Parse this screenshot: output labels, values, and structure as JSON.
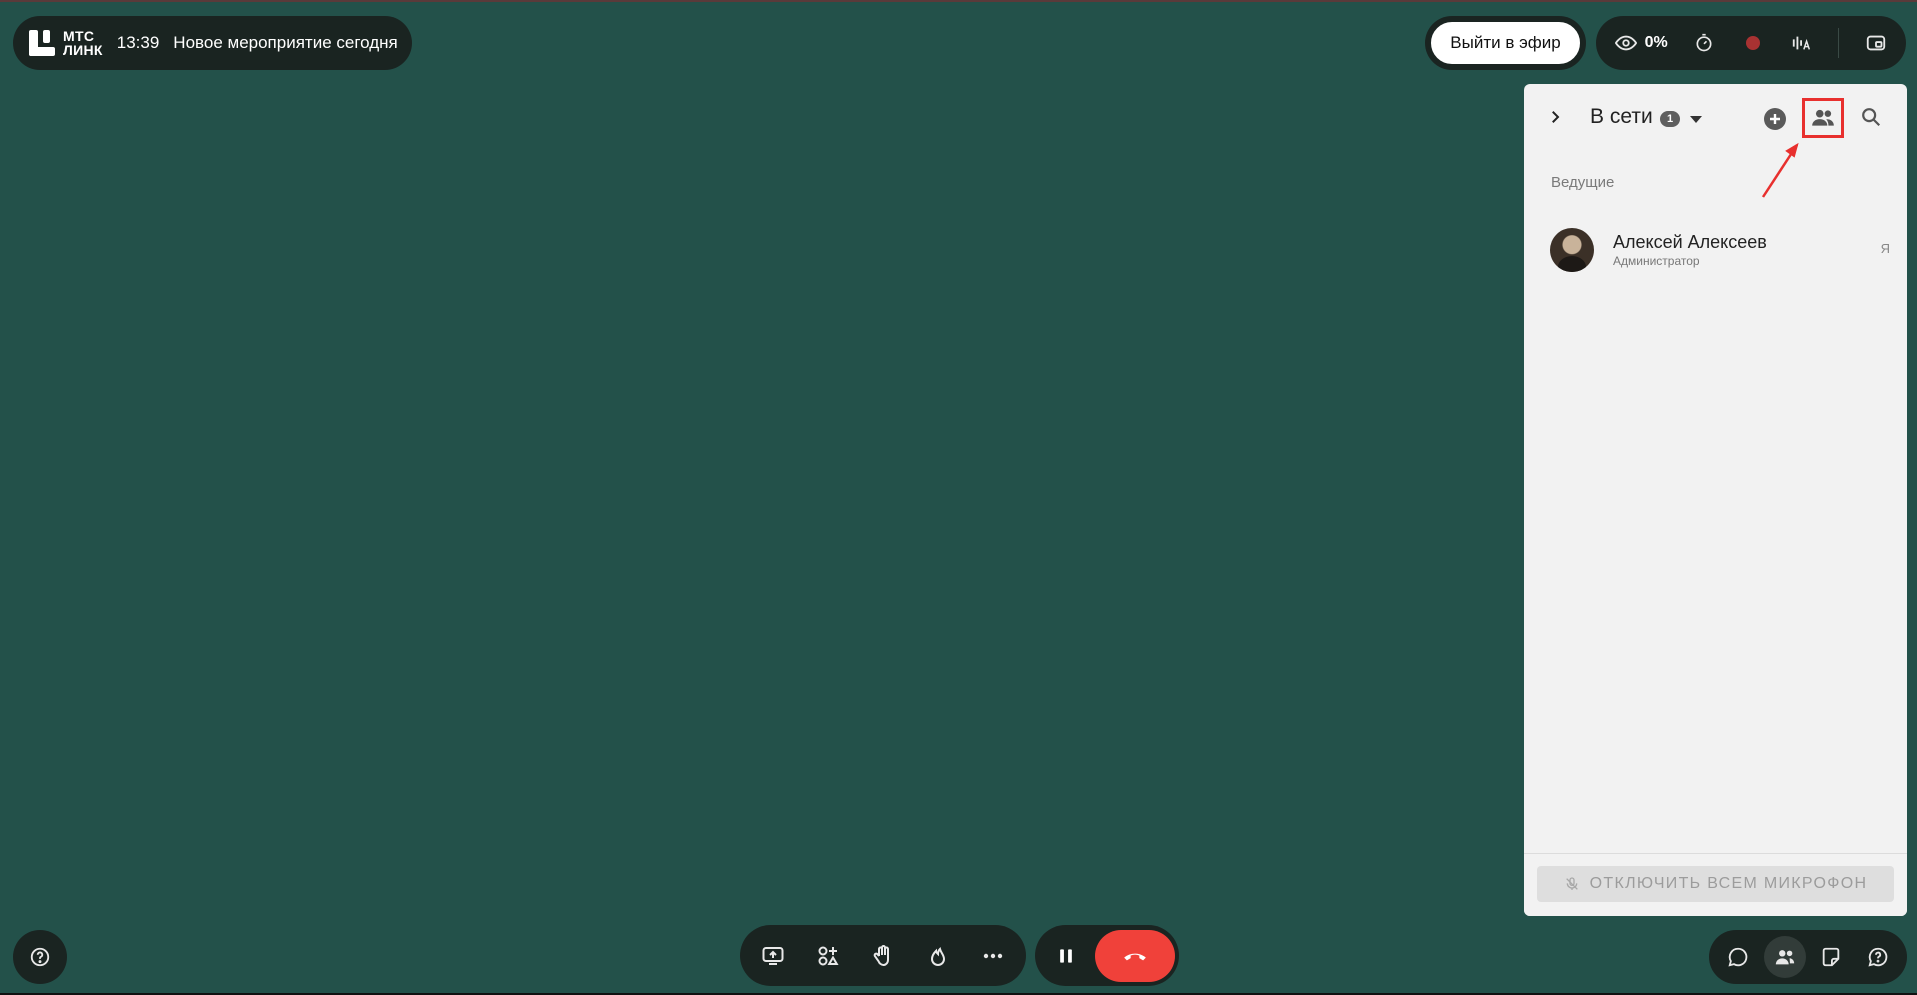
{
  "header": {
    "logo_line1": "МТС",
    "logo_line2": "ЛИНК",
    "time": "13:39",
    "event_title": "Новое мероприятие сегодня"
  },
  "top_right": {
    "go_live_label": "Выйти в эфир",
    "viewers_percent": "0%",
    "icons": [
      "eye-icon",
      "timer-icon",
      "record-icon",
      "audio-translate-icon",
      "picture-in-picture-icon"
    ]
  },
  "panel": {
    "title": "В сети",
    "count": "1",
    "section_label": "Ведущие",
    "members": [
      {
        "name": "Алексей Алексеев",
        "role": "Администратор",
        "me_label": "Я"
      }
    ],
    "mute_all_label": "ОТКЛЮЧИТЬ ВСЕМ МИКРОФОН"
  },
  "toolbar": {
    "icons": [
      "screen-share-icon",
      "apps-icon",
      "raise-hand-icon",
      "reaction-icon",
      "more-icon"
    ]
  },
  "call": {
    "icons": [
      "pause-icon",
      "hangup-icon"
    ]
  },
  "bottom_right": {
    "icons": [
      "chat-icon",
      "participants-icon",
      "notes-icon",
      "questions-icon"
    ],
    "active": "participants-icon"
  },
  "colors": {
    "background": "#23514A",
    "pill": "#1a2421",
    "hangup": "#f0413a",
    "annotation": "#e8302e",
    "record": "#a83232"
  }
}
